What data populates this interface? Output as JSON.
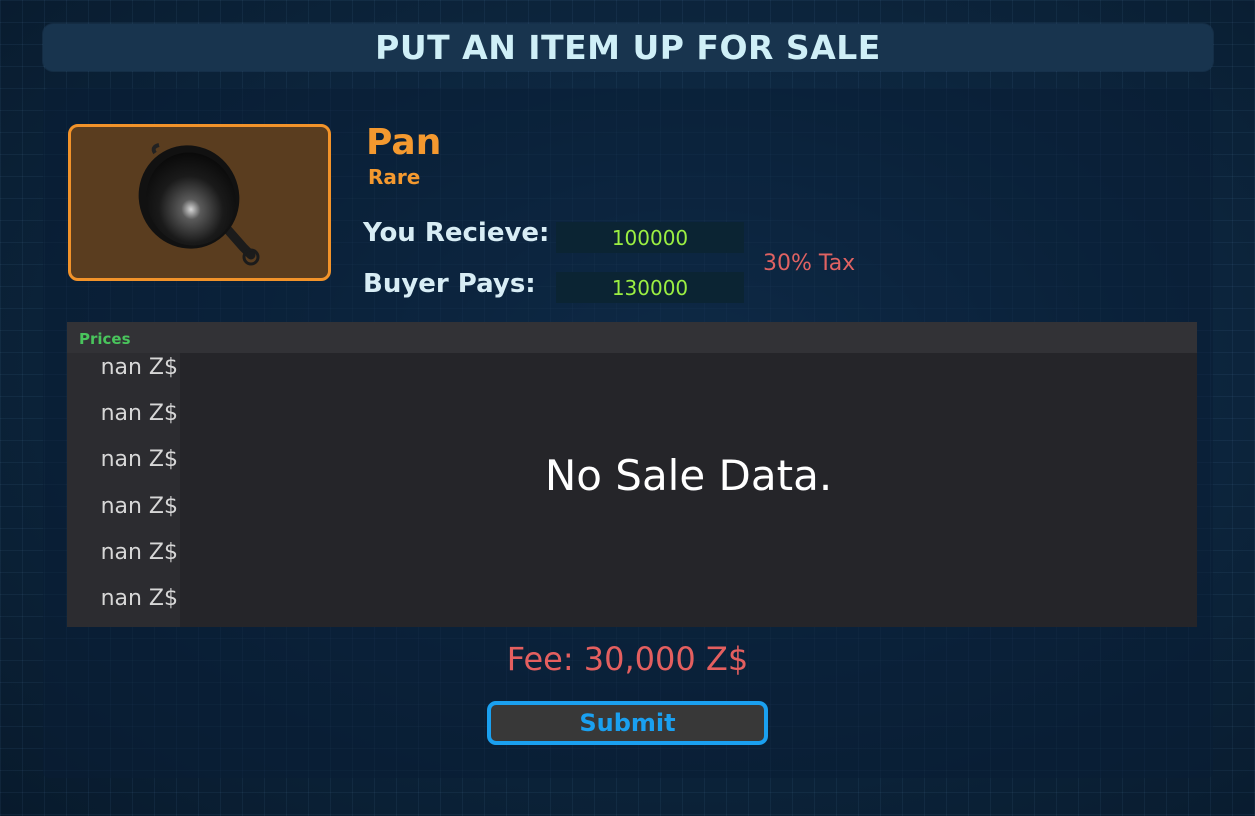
{
  "window": {
    "title": "PUT AN ITEM UP FOR SALE"
  },
  "item": {
    "name": "Pan",
    "rarity": "Rare",
    "icon": "frying-pan-icon",
    "frame_color": "#f2932a",
    "name_color": "#f4992f"
  },
  "pricing": {
    "receive_label": "You Recieve:",
    "receive_value": "100000",
    "buyer_label": "Buyer Pays:",
    "buyer_value": "130000",
    "tax_label": "30% Tax",
    "value_color": "#9bef42",
    "tax_color": "#e06262"
  },
  "prices_panel": {
    "title": "Prices",
    "axis_labels": [
      "nan Z$",
      "nan Z$",
      "nan Z$",
      "nan Z$",
      "nan Z$",
      "nan Z$"
    ],
    "empty_message": "No Sale Data."
  },
  "fee": {
    "label": "Fee: 30,000 Z$"
  },
  "submit": {
    "label": "Submit",
    "accent": "#1aa0f0"
  }
}
